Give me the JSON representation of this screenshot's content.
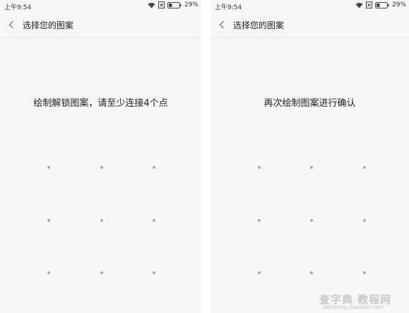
{
  "screens": [
    {
      "status": {
        "time": "上午9:54",
        "battery": "29%"
      },
      "title": "选择您的图案",
      "instruction": "绘制解锁图案，请至少连接4个点"
    },
    {
      "status": {
        "time": "上午9:54",
        "battery": "29%"
      },
      "title": "选择您的图案",
      "instruction": "再次绘制图案进行确认"
    }
  ],
  "watermark": {
    "main": "查字典 教程网",
    "sub": "jiaocheng.chazidian.com"
  },
  "colors": {
    "background": "#f6f6f6",
    "dot": "#a9a9a9",
    "text": "#222222"
  },
  "icons": [
    "wifi-icon",
    "no-sim-icon",
    "battery-icon",
    "back-arrow-icon"
  ]
}
